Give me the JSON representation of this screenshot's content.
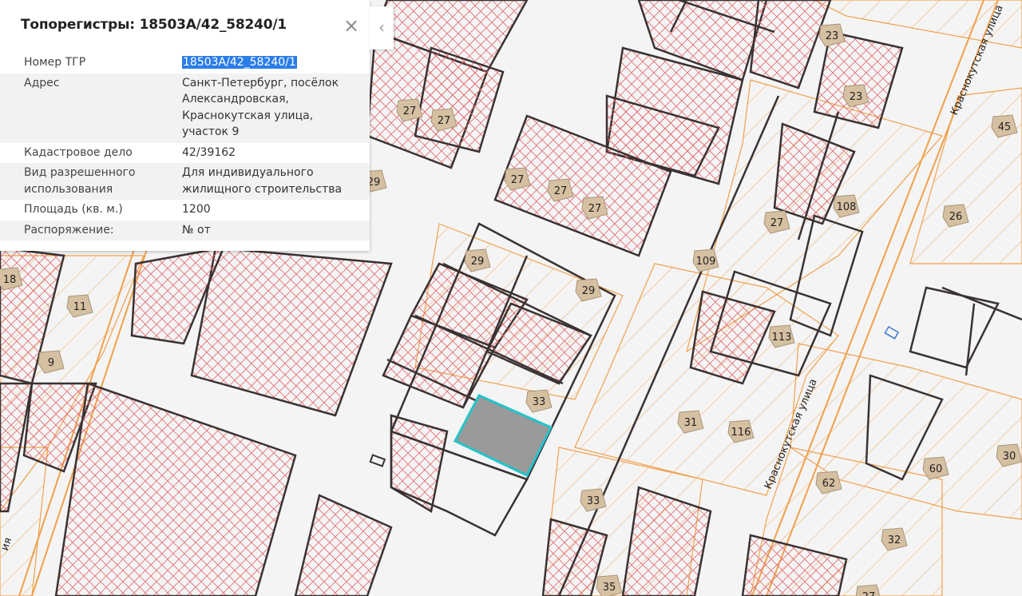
{
  "panel": {
    "title": "Топорегистры: 18503A/42_58240/1",
    "rows": [
      {
        "key": "Номер ТГР",
        "value": "18503A/42_58240/1"
      },
      {
        "key": "Адрес",
        "value": "Санкт-Петербург, посёлок Александровская, Краснокутская улица, участок 9"
      },
      {
        "key": "Кадастровое дело",
        "value": "42/39162"
      },
      {
        "key": "Вид разрешенного использования",
        "value": "Для индивидуального жилищного строительства"
      },
      {
        "key": "Площадь (кв. м.)",
        "value": "1200"
      },
      {
        "key": "Распоряжение:",
        "value": "№ от"
      }
    ]
  },
  "map": {
    "street_labels": [
      "Краснокутская улица",
      "Краснокутская улица",
      "ия"
    ],
    "house_numbers": [
      "23",
      "23",
      "27",
      "27",
      "45",
      "29",
      "27",
      "27",
      "27",
      "108",
      "27",
      "26",
      "109",
      "18",
      "11",
      "29",
      "29",
      "113",
      "9",
      "33",
      "31",
      "116",
      "60",
      "30",
      "62",
      "33",
      "32",
      "35",
      "27"
    ],
    "colors": {
      "background": "#f4f4f4",
      "parcel_orange": "#f0a04b",
      "hatch_red": "#e0535b",
      "boundary": "#3a3232",
      "selected_fill": "#9a9a9a",
      "selected_outline": "#22c3c9",
      "building": "#d6c0a2"
    }
  }
}
